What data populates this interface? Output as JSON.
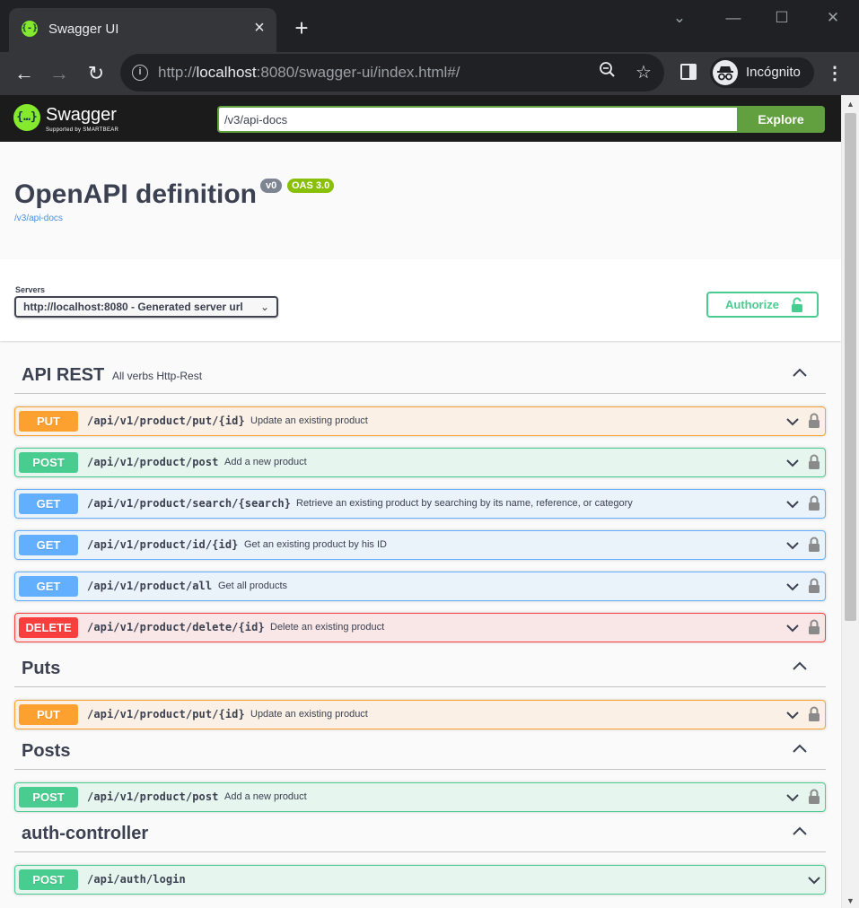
{
  "browser": {
    "tab_title": "Swagger UI",
    "tab_favicon": "{-}",
    "url_prefix": "http://",
    "url_host": "localhost",
    "url_rest": ":8080/swagger-ui/index.html#/",
    "profile_label": "Incógnito"
  },
  "topbar": {
    "logo_text": "Swagger",
    "logo_sub": "Supported by SMARTBEAR",
    "logo_mark": "{…}",
    "spec_url": "/v3/api-docs",
    "explore_label": "Explore"
  },
  "info": {
    "title": "OpenAPI definition",
    "version": "v0",
    "oas": "OAS 3.0",
    "spec_link": "/v3/api-docs"
  },
  "servers": {
    "label": "Servers",
    "selected": "http://localhost:8080 - Generated server url"
  },
  "authorize_label": "Authorize",
  "colors": {
    "put": "#fca130",
    "post": "#49cc90",
    "get": "#61affe",
    "delete": "#f93e3e",
    "swagger_green": "#85ea2d",
    "explore_green": "#62a03f"
  },
  "tags": [
    {
      "name": "API REST",
      "description": "All verbs Http-Rest",
      "operations": [
        {
          "method": "PUT",
          "path": "/api/v1/product/put/{id}",
          "summary": "Update an existing product",
          "locked": true
        },
        {
          "method": "POST",
          "path": "/api/v1/product/post",
          "summary": "Add a new product",
          "locked": true
        },
        {
          "method": "GET",
          "path": "/api/v1/product/search/{search}",
          "summary": "Retrieve an existing product by searching by its name, reference, or category",
          "locked": true
        },
        {
          "method": "GET",
          "path": "/api/v1/product/id/{id}",
          "summary": "Get an existing product by his ID",
          "locked": true
        },
        {
          "method": "GET",
          "path": "/api/v1/product/all",
          "summary": "Get all products",
          "locked": true
        },
        {
          "method": "DELETE",
          "path": "/api/v1/product/delete/{id}",
          "summary": "Delete an existing product",
          "locked": true
        }
      ]
    },
    {
      "name": "Puts",
      "description": "",
      "operations": [
        {
          "method": "PUT",
          "path": "/api/v1/product/put/{id}",
          "summary": "Update an existing product",
          "locked": true
        }
      ]
    },
    {
      "name": "Posts",
      "description": "",
      "operations": [
        {
          "method": "POST",
          "path": "/api/v1/product/post",
          "summary": "Add a new product",
          "locked": true
        }
      ]
    },
    {
      "name": "auth-controller",
      "description": "",
      "operations": [
        {
          "method": "POST",
          "path": "/api/auth/login",
          "summary": "",
          "locked": false
        }
      ]
    }
  ]
}
